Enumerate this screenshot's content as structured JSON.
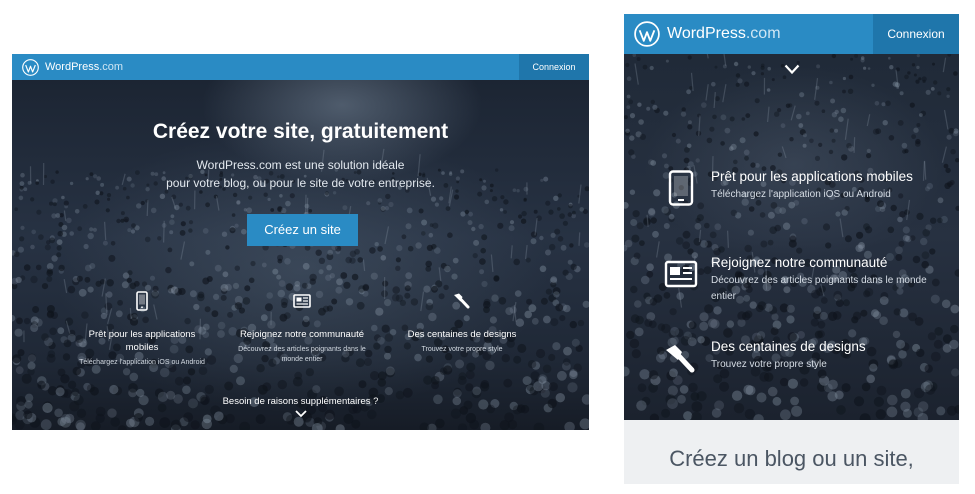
{
  "desktop": {
    "brand": {
      "main": "WordPress",
      "suffix": ".com"
    },
    "login_label": "Connexion",
    "hero": {
      "title": "Créez votre site, gratuitement",
      "subtitle_line1": "WordPress.com est une solution idéale",
      "subtitle_line2": "pour votre blog, ou pour le site de votre entreprise.",
      "cta_label": "Créez un site"
    },
    "features": [
      {
        "icon": "phone-icon",
        "title": "Prêt pour les applications mobiles",
        "desc": "Téléchargez l'application iOS ou Android"
      },
      {
        "icon": "newspaper-icon",
        "title": "Rejoignez notre communauté",
        "desc": "Découvrez des articles poignants dans le monde entier"
      },
      {
        "icon": "paintbrush-icon",
        "title": "Des centaines de designs",
        "desc": "Trouvez votre propre style"
      }
    ],
    "more_label": "Besoin de raisons supplémentaires ?"
  },
  "mobile": {
    "brand": {
      "main": "WordPress",
      "suffix": ".com"
    },
    "login_label": "Connexion",
    "features": [
      {
        "icon": "phone-icon",
        "title": "Prêt pour les applications mobiles",
        "desc": "Téléchargez l'application iOS ou Android"
      },
      {
        "icon": "newspaper-icon",
        "title": "Rejoignez notre communauté",
        "desc": "Découvrez des articles poignants dans le monde entier"
      },
      {
        "icon": "paintbrush-icon",
        "title": "Des centaines de designs",
        "desc": "Trouvez votre propre style"
      }
    ],
    "footer_title": "Créez un blog ou un site,"
  },
  "colors": {
    "brand_blue": "#2a8bc4",
    "brand_blue_dark": "#1f76ab",
    "hero_dark": "#1f2836",
    "footer_bg": "#eef0f2"
  }
}
